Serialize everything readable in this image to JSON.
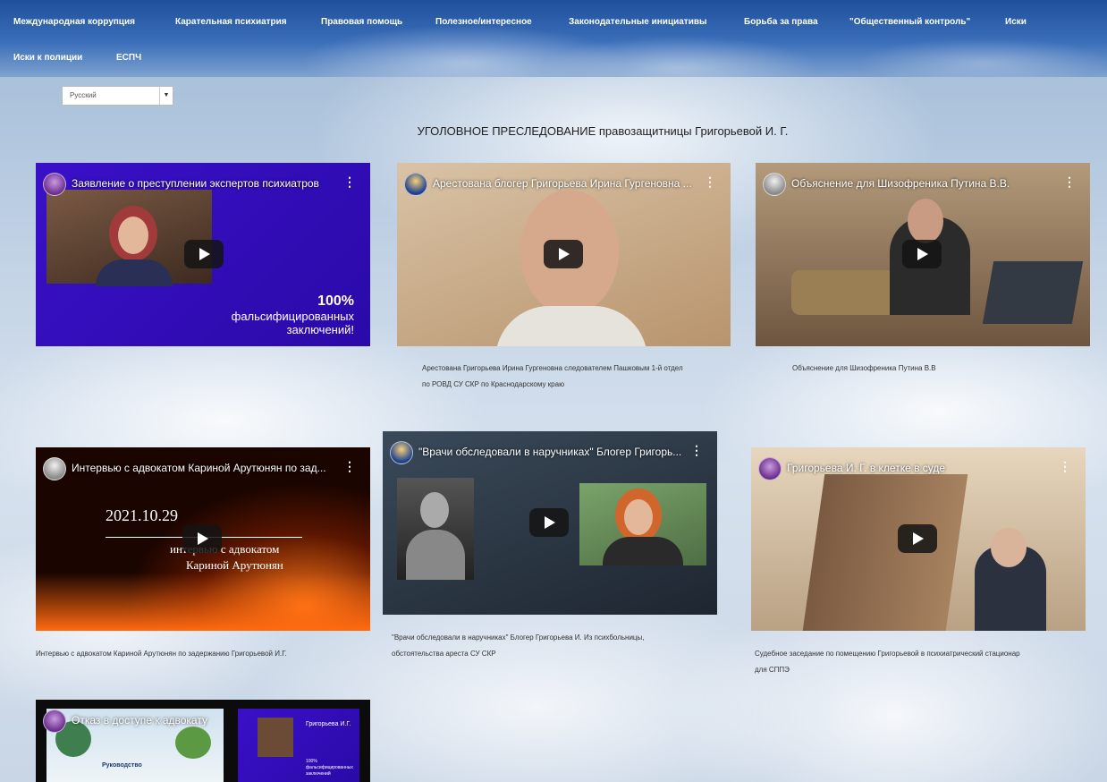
{
  "nav": {
    "items": [
      "Международная коррупция",
      "Карательная психиатрия",
      "Правовая помощь",
      "Полезное/интересное",
      "Законодательные инициативы",
      "Борьба за права",
      "\"Общественный контроль\"",
      "Иски",
      "Иски к полиции",
      "ЕСПЧ"
    ]
  },
  "language": {
    "selected": "Русский"
  },
  "page_title": "УГОЛОВНОЕ ПРЕСЛЕДОВАНИЕ правозащитницы Григорьевой И. Г.",
  "videos": [
    {
      "title": "Заявление о преступлении экспертов психиатров",
      "overlay_big": "100%",
      "overlay_small1": "фальсифицированных",
      "overlay_small2": "заключений!",
      "caption": ""
    },
    {
      "title": "Арестована блогер Григорьева Ирина Гургеновна ...",
      "caption_line1": "Арестована Григорьева Ирина Гургеновна следователем Пашковым 1-й отдел",
      "caption_line2": "по РОВД СУ СКР по Краснодарскому краю"
    },
    {
      "title": "Объяснение для Шизофреника Путина В.В.",
      "caption_line1": "Объяснение для Шизофреника Путина В.В"
    },
    {
      "title": "Интервью с адвокатом Кариной Арутюнян по зад...",
      "overlay_date": "2021.10.29",
      "overlay_line1": "интервью с адвокатом",
      "overlay_line2": "Кариной Арутюнян",
      "caption_line1": "Интервью с адвокатом Кариной Арутюнян по задержанию Григорьевой И.Г."
    },
    {
      "title": "\"Врачи обследовали в наручниках\" Блогер Григорь...",
      "caption_line1": "\"Врачи обследовали в наручниках\" Блогер Григорьева И. Из психбольницы,",
      "caption_line2": "обстоятельства ареста СУ СКР"
    },
    {
      "title": "Григорьева И. Г. в клетке в суде",
      "caption_line1": "Судебное заседание по помещению Григорьевой в психиатрический стационар",
      "caption_line2": "для СППЭ"
    },
    {
      "title": "Отказ в доступе к адвокату",
      "side_label": "Григорьева И.Г.",
      "doc_heading": "Руководство",
      "side_caption": "100% фальсифицированных заключений"
    }
  ]
}
